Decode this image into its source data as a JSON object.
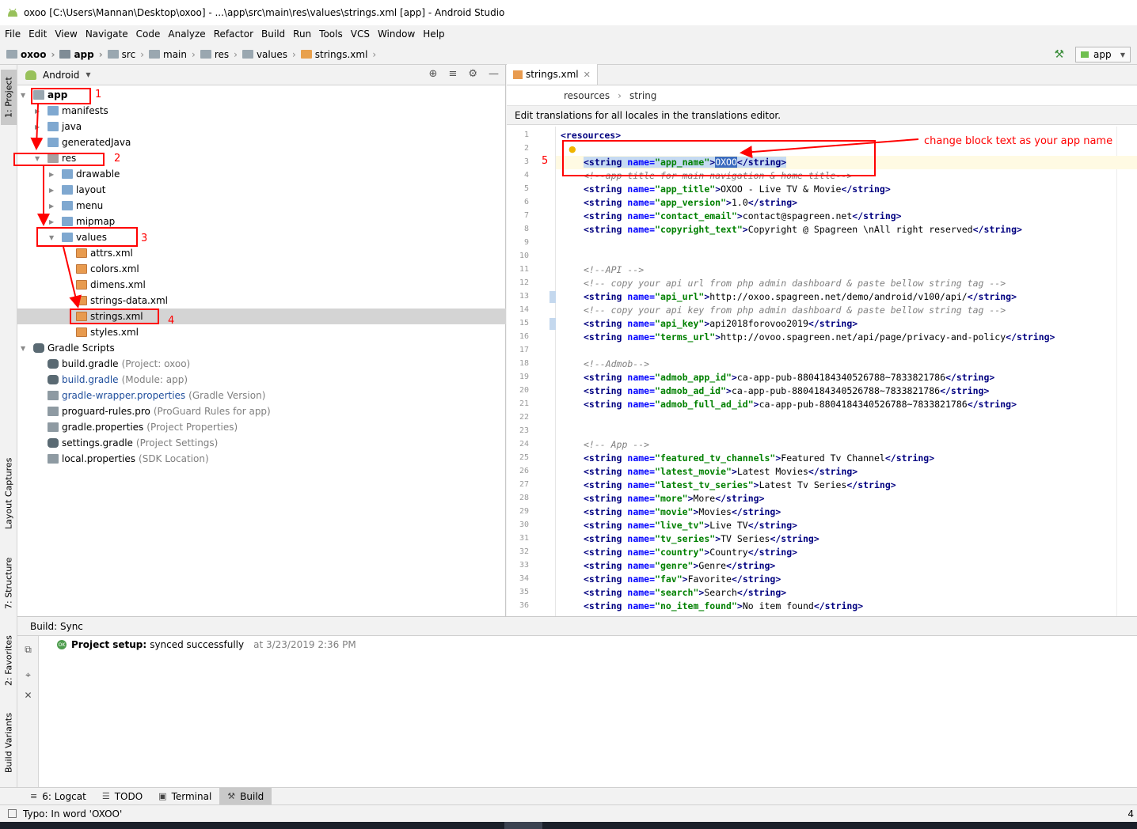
{
  "window": {
    "title": "oxoo [C:\\Users\\Mannan\\Desktop\\oxoo] - ...\\app\\src\\main\\res\\values\\strings.xml [app] - Android Studio"
  },
  "menu": [
    "File",
    "Edit",
    "View",
    "Navigate",
    "Code",
    "Analyze",
    "Refactor",
    "Build",
    "Run",
    "Tools",
    "VCS",
    "Window",
    "Help"
  ],
  "breadcrumbs": [
    "oxoo",
    "app",
    "src",
    "main",
    "res",
    "values",
    "strings.xml"
  ],
  "run_config": "app",
  "left_tool_tabs": [
    "1: Project",
    "Layout Captures",
    "7: Structure",
    "2: Favorites",
    "Build Variants"
  ],
  "project_panel": {
    "view_mode": "Android",
    "tree": [
      {
        "label": "app",
        "level": 0,
        "expanded": true,
        "icon": "module-folder-icon",
        "bold": true
      },
      {
        "label": "manifests",
        "level": 1,
        "expanded": false,
        "icon": "folder-icon"
      },
      {
        "label": "java",
        "level": 1,
        "expanded": false,
        "icon": "folder-icon"
      },
      {
        "label": "generatedJava",
        "level": 1,
        "expanded": false,
        "icon": "folder-icon"
      },
      {
        "label": "res",
        "level": 1,
        "expanded": true,
        "icon": "res-folder-icon"
      },
      {
        "label": "drawable",
        "level": 2,
        "expanded": false,
        "icon": "folder-icon"
      },
      {
        "label": "layout",
        "level": 2,
        "expanded": false,
        "icon": "folder-icon"
      },
      {
        "label": "menu",
        "level": 2,
        "expanded": false,
        "icon": "folder-icon"
      },
      {
        "label": "mipmap",
        "level": 2,
        "expanded": false,
        "icon": "folder-icon"
      },
      {
        "label": "values",
        "level": 2,
        "expanded": true,
        "icon": "folder-icon"
      },
      {
        "label": "attrs.xml",
        "level": 3,
        "icon": "xml-file-icon"
      },
      {
        "label": "colors.xml",
        "level": 3,
        "icon": "xml-file-icon"
      },
      {
        "label": "dimens.xml",
        "level": 3,
        "icon": "xml-file-icon"
      },
      {
        "label": "strings-data.xml",
        "level": 3,
        "icon": "xml-file-icon"
      },
      {
        "label": "strings.xml",
        "level": 3,
        "icon": "xml-file-icon",
        "selected": true
      },
      {
        "label": "styles.xml",
        "level": 3,
        "icon": "xml-file-icon"
      },
      {
        "label": "Gradle Scripts",
        "level": 0,
        "expanded": true,
        "icon": "gradle-icon"
      },
      {
        "label": "build.gradle",
        "level": 1,
        "icon": "gradle-icon",
        "hint": "(Project: oxoo)"
      },
      {
        "label": "build.gradle",
        "level": 1,
        "icon": "gradle-icon",
        "hint": "(Module: app)",
        "blue": true
      },
      {
        "label": "gradle-wrapper.properties",
        "level": 1,
        "icon": "properties-icon",
        "hint": "(Gradle Version)",
        "blue": true
      },
      {
        "label": "proguard-rules.pro",
        "level": 1,
        "icon": "properties-icon",
        "hint": "(ProGuard Rules for app)"
      },
      {
        "label": "gradle.properties",
        "level": 1,
        "icon": "properties-icon",
        "hint": "(Project Properties)"
      },
      {
        "label": "settings.gradle",
        "level": 1,
        "icon": "gradle-icon",
        "hint": "(Project Settings)"
      },
      {
        "label": "local.properties",
        "level": 1,
        "icon": "properties-icon",
        "hint": "(SDK Location)"
      }
    ]
  },
  "annotations": {
    "numbers": [
      "1",
      "2",
      "3",
      "4",
      "5"
    ],
    "callout": "change block text as your app name"
  },
  "editor": {
    "tab": "strings.xml",
    "breadcrumb": [
      "resources",
      "string"
    ],
    "notice": "Edit translations for all locales in the translations editor.",
    "lines": [
      {
        "n": "1",
        "segs": [
          [
            "tag",
            "<resources>"
          ]
        ]
      },
      {
        "n": "2",
        "segs": []
      },
      {
        "n": "3",
        "segs": [
          [
            "tag",
            "<string "
          ],
          [
            "attr",
            "name="
          ],
          [
            "val",
            "\"app_name\""
          ],
          [
            "tag",
            ">"
          ],
          [
            "sel",
            "OXOO"
          ],
          [
            "tag",
            "</string>"
          ]
        ],
        "current": true
      },
      {
        "n": "4",
        "segs": [
          [
            "cmt",
            "<!--app title for main navigation & home title-->"
          ]
        ]
      },
      {
        "n": "5",
        "segs": [
          [
            "tag",
            "<string "
          ],
          [
            "attr",
            "name="
          ],
          [
            "val",
            "\"app_title\""
          ],
          [
            "tag",
            ">"
          ],
          [
            "txt",
            "OXOO - Live TV & Movie"
          ],
          [
            "tag",
            "</string>"
          ]
        ]
      },
      {
        "n": "6",
        "segs": [
          [
            "tag",
            "<string "
          ],
          [
            "attr",
            "name="
          ],
          [
            "val",
            "\"app_version\""
          ],
          [
            "tag",
            ">"
          ],
          [
            "txt",
            "1.0"
          ],
          [
            "tag",
            "</string>"
          ]
        ]
      },
      {
        "n": "7",
        "segs": [
          [
            "tag",
            "<string "
          ],
          [
            "attr",
            "name="
          ],
          [
            "val",
            "\"contact_email\""
          ],
          [
            "tag",
            ">"
          ],
          [
            "txt",
            "contact@spagreen.net"
          ],
          [
            "tag",
            "</string>"
          ]
        ]
      },
      {
        "n": "8",
        "segs": [
          [
            "tag",
            "<string "
          ],
          [
            "attr",
            "name="
          ],
          [
            "val",
            "\"copyright_text\""
          ],
          [
            "tag",
            ">"
          ],
          [
            "txt",
            "Copyright @ Spagreen \\nAll right reserved"
          ],
          [
            "tag",
            "</string>"
          ]
        ]
      },
      {
        "n": "9",
        "segs": []
      },
      {
        "n": "10",
        "segs": []
      },
      {
        "n": "11",
        "segs": [
          [
            "cmt",
            "<!--API -->"
          ]
        ]
      },
      {
        "n": "12",
        "segs": [
          [
            "cmt",
            "<!-- copy your api url from php admin dashboard & paste bellow string tag -->"
          ]
        ]
      },
      {
        "n": "13",
        "segs": [
          [
            "tag",
            "<string "
          ],
          [
            "attr",
            "name="
          ],
          [
            "val",
            "\"api_url\""
          ],
          [
            "tag",
            ">"
          ],
          [
            "txt",
            "http://oxoo.spagreen.net/demo/android/v100/api/"
          ],
          [
            "tag",
            "</string>"
          ]
        ],
        "marker": true
      },
      {
        "n": "14",
        "segs": [
          [
            "cmt",
            "<!-- copy your api key from php admin dashboard & paste bellow string tag -->"
          ]
        ]
      },
      {
        "n": "15",
        "segs": [
          [
            "tag",
            "<string "
          ],
          [
            "attr",
            "name="
          ],
          [
            "val",
            "\"api_key\""
          ],
          [
            "tag",
            ">"
          ],
          [
            "txt",
            "api2018forovoo2019"
          ],
          [
            "tag",
            "</string>"
          ]
        ],
        "marker": true
      },
      {
        "n": "16",
        "segs": [
          [
            "tag",
            "<string "
          ],
          [
            "attr",
            "name="
          ],
          [
            "val",
            "\"terms_url\""
          ],
          [
            "tag",
            ">"
          ],
          [
            "txt",
            "http://ovoo.spagreen.net/api/page/privacy-and-policy"
          ],
          [
            "tag",
            "</string>"
          ]
        ]
      },
      {
        "n": "17",
        "segs": []
      },
      {
        "n": "18",
        "segs": [
          [
            "cmt",
            "<!--Admob-->"
          ]
        ]
      },
      {
        "n": "19",
        "segs": [
          [
            "tag",
            "<string "
          ],
          [
            "attr",
            "name="
          ],
          [
            "val",
            "\"admob_app_id\""
          ],
          [
            "tag",
            ">"
          ],
          [
            "txt",
            "ca-app-pub-8804184340526788~7833821786"
          ],
          [
            "tag",
            "</string>"
          ]
        ]
      },
      {
        "n": "20",
        "segs": [
          [
            "tag",
            "<string "
          ],
          [
            "attr",
            "name="
          ],
          [
            "val",
            "\"admob_ad_id\""
          ],
          [
            "tag",
            ">"
          ],
          [
            "txt",
            "ca-app-pub-8804184340526788~7833821786"
          ],
          [
            "tag",
            "</string>"
          ]
        ]
      },
      {
        "n": "21",
        "segs": [
          [
            "tag",
            "<string "
          ],
          [
            "attr",
            "name="
          ],
          [
            "val",
            "\"admob_full_ad_id\""
          ],
          [
            "tag",
            ">"
          ],
          [
            "txt",
            "ca-app-pub-8804184340526788~7833821786"
          ],
          [
            "tag",
            "</string>"
          ]
        ]
      },
      {
        "n": "22",
        "segs": []
      },
      {
        "n": "23",
        "segs": []
      },
      {
        "n": "24",
        "segs": [
          [
            "cmt",
            "<!-- App -->"
          ]
        ]
      },
      {
        "n": "25",
        "segs": [
          [
            "tag",
            "<string "
          ],
          [
            "attr",
            "name="
          ],
          [
            "val",
            "\"featured_tv_channels\""
          ],
          [
            "tag",
            ">"
          ],
          [
            "txt",
            "Featured Tv Channel"
          ],
          [
            "tag",
            "</string>"
          ]
        ]
      },
      {
        "n": "26",
        "segs": [
          [
            "tag",
            "<string "
          ],
          [
            "attr",
            "name="
          ],
          [
            "val",
            "\"latest_movie\""
          ],
          [
            "tag",
            ">"
          ],
          [
            "txt",
            "Latest Movies"
          ],
          [
            "tag",
            "</string>"
          ]
        ]
      },
      {
        "n": "27",
        "segs": [
          [
            "tag",
            "<string "
          ],
          [
            "attr",
            "name="
          ],
          [
            "val",
            "\"latest_tv_series\""
          ],
          [
            "tag",
            ">"
          ],
          [
            "txt",
            "Latest Tv Series"
          ],
          [
            "tag",
            "</string>"
          ]
        ]
      },
      {
        "n": "28",
        "segs": [
          [
            "tag",
            "<string "
          ],
          [
            "attr",
            "name="
          ],
          [
            "val",
            "\"more\""
          ],
          [
            "tag",
            ">"
          ],
          [
            "txt",
            "More"
          ],
          [
            "tag",
            "</string>"
          ]
        ]
      },
      {
        "n": "29",
        "segs": [
          [
            "tag",
            "<string "
          ],
          [
            "attr",
            "name="
          ],
          [
            "val",
            "\"movie\""
          ],
          [
            "tag",
            ">"
          ],
          [
            "txt",
            "Movies"
          ],
          [
            "tag",
            "</string>"
          ]
        ]
      },
      {
        "n": "30",
        "segs": [
          [
            "tag",
            "<string "
          ],
          [
            "attr",
            "name="
          ],
          [
            "val",
            "\"live_tv\""
          ],
          [
            "tag",
            ">"
          ],
          [
            "txt",
            "Live TV"
          ],
          [
            "tag",
            "</string>"
          ]
        ]
      },
      {
        "n": "31",
        "segs": [
          [
            "tag",
            "<string "
          ],
          [
            "attr",
            "name="
          ],
          [
            "val",
            "\"tv_series\""
          ],
          [
            "tag",
            ">"
          ],
          [
            "txt",
            "TV Series"
          ],
          [
            "tag",
            "</string>"
          ]
        ]
      },
      {
        "n": "32",
        "segs": [
          [
            "tag",
            "<string "
          ],
          [
            "attr",
            "name="
          ],
          [
            "val",
            "\"country\""
          ],
          [
            "tag",
            ">"
          ],
          [
            "txt",
            "Country"
          ],
          [
            "tag",
            "</string>"
          ]
        ]
      },
      {
        "n": "33",
        "segs": [
          [
            "tag",
            "<string "
          ],
          [
            "attr",
            "name="
          ],
          [
            "val",
            "\"genre\""
          ],
          [
            "tag",
            ">"
          ],
          [
            "txt",
            "Genre"
          ],
          [
            "tag",
            "</string>"
          ]
        ]
      },
      {
        "n": "34",
        "segs": [
          [
            "tag",
            "<string "
          ],
          [
            "attr",
            "name="
          ],
          [
            "val",
            "\"fav\""
          ],
          [
            "tag",
            ">"
          ],
          [
            "txt",
            "Favorite"
          ],
          [
            "tag",
            "</string>"
          ]
        ]
      },
      {
        "n": "35",
        "segs": [
          [
            "tag",
            "<string "
          ],
          [
            "attr",
            "name="
          ],
          [
            "val",
            "\"search\""
          ],
          [
            "tag",
            ">"
          ],
          [
            "txt",
            "Search"
          ],
          [
            "tag",
            "</string>"
          ]
        ]
      },
      {
        "n": "36",
        "segs": [
          [
            "tag",
            "<string "
          ],
          [
            "attr",
            "name="
          ],
          [
            "val",
            "\"no_item_found\""
          ],
          [
            "tag",
            ">"
          ],
          [
            "txt",
            "No item found"
          ],
          [
            "tag",
            "</string>"
          ]
        ]
      }
    ]
  },
  "build": {
    "header": "Build: Sync",
    "message_bold": "Project setup:",
    "message": "synced successfully",
    "time": "at 3/23/2019 2:36 PM",
    "ok_badge": "OK"
  },
  "bottom_tabs": [
    {
      "label": "6: Logcat",
      "icon": "logcat-icon"
    },
    {
      "label": "TODO",
      "icon": "todo-icon"
    },
    {
      "label": "Terminal",
      "icon": "terminal-icon"
    },
    {
      "label": "Build",
      "icon": "build-icon",
      "active": true
    }
  ],
  "status": {
    "text": "Typo: In word 'OXOO'",
    "right": "4"
  }
}
